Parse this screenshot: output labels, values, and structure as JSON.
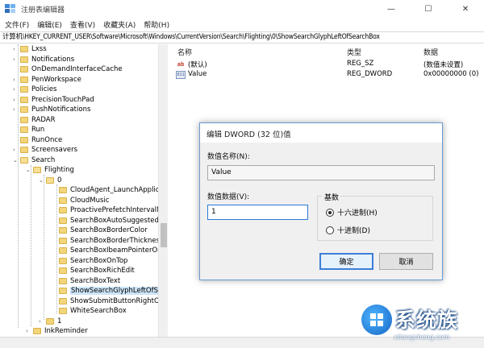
{
  "window": {
    "title": "注册表编辑器",
    "minimize": "—",
    "maximize": "☐",
    "close": "✕"
  },
  "menu": [
    "文件(F)",
    "编辑(E)",
    "查看(V)",
    "收藏夹(A)",
    "帮助(H)"
  ],
  "address": "计算机\\HKEY_CURRENT_USER\\Software\\Microsoft\\Windows\\CurrentVersion\\Search\\Flighting\\0\\ShowSearchGlyphLeftOfSearchBox",
  "tree": [
    {
      "label": "Lxss",
      "twisty": "›"
    },
    {
      "label": "Notifications",
      "twisty": "›"
    },
    {
      "label": "OnDemandInterfaceCache",
      "twisty": ""
    },
    {
      "label": "PenWorkspace",
      "twisty": "›"
    },
    {
      "label": "Policies",
      "twisty": "›"
    },
    {
      "label": "PrecisionTouchPad",
      "twisty": "›"
    },
    {
      "label": "PushNotifications",
      "twisty": "›"
    },
    {
      "label": "RADAR",
      "twisty": ""
    },
    {
      "label": "Run",
      "twisty": ""
    },
    {
      "label": "RunOnce",
      "twisty": ""
    },
    {
      "label": "Screensavers",
      "twisty": "›"
    },
    {
      "label": "Search",
      "twisty": "⌄"
    },
    {
      "label": "Flighting",
      "twisty": "⌄"
    },
    {
      "label": "0",
      "twisty": "⌄"
    },
    {
      "label": "CloudAgent_LaunchApplicati",
      "twisty": ""
    },
    {
      "label": "CloudMusic",
      "twisty": ""
    },
    {
      "label": "ProactivePrefetchIntervalMin",
      "twisty": ""
    },
    {
      "label": "SearchBoxAutoSuggestedFo",
      "twisty": ""
    },
    {
      "label": "SearchBoxBorderColor",
      "twisty": ""
    },
    {
      "label": "SearchBoxBorderThickness",
      "twisty": ""
    },
    {
      "label": "SearchBoxIbeamPointerOnH",
      "twisty": ""
    },
    {
      "label": "SearchBoxOnTop",
      "twisty": ""
    },
    {
      "label": "SearchBoxRichEdit",
      "twisty": ""
    },
    {
      "label": "SearchBoxText",
      "twisty": ""
    },
    {
      "label": "ShowSearchGlyphLeftOfSear",
      "twisty": ""
    },
    {
      "label": "ShowSubmitButtonRightOfSe",
      "twisty": ""
    },
    {
      "label": "WhiteSearchBox",
      "twisty": ""
    },
    {
      "label": "1",
      "twisty": "›"
    },
    {
      "label": "InkReminder",
      "twisty": "›"
    }
  ],
  "list": {
    "headers": {
      "name": "名称",
      "type": "类型",
      "data": "数据"
    },
    "rows": [
      {
        "icon": "ab",
        "name": "(默认)",
        "type": "REG_SZ",
        "data": "(数值未设置)"
      },
      {
        "icon": "011",
        "name": "Value",
        "type": "REG_DWORD",
        "data": "0x00000000 (0)"
      }
    ]
  },
  "dialog": {
    "title": "编辑 DWORD (32 位)值",
    "name_label": "数值名称(N):",
    "name_value": "Value",
    "data_label": "数值数据(V):",
    "data_value": "1",
    "base_title": "基数",
    "hex_label": "十六进制(H)",
    "dec_label": "十进制(D)",
    "ok": "确定",
    "cancel": "取消"
  },
  "watermark": {
    "brand": "系统族",
    "url": "xitongcheng.com"
  }
}
